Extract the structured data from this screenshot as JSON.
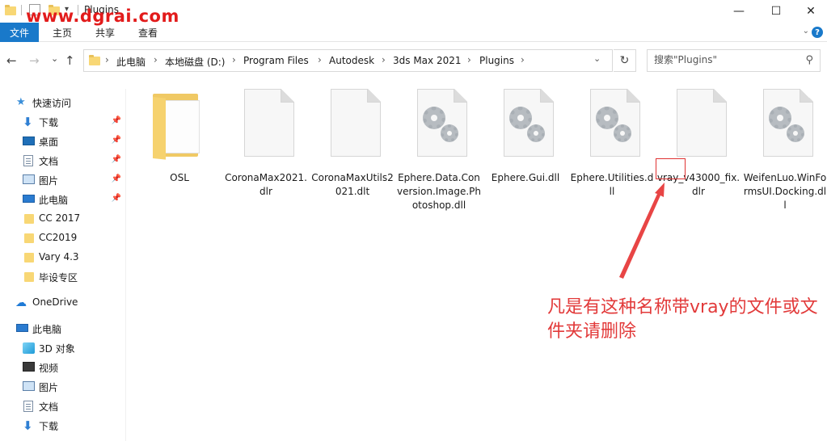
{
  "window": {
    "title": "Plugins",
    "minimize": "—",
    "maximize": "☐",
    "close": "✕"
  },
  "watermark": "www.dgrai.com",
  "ribbon": {
    "file_tab": "文件",
    "tabs": [
      "主页",
      "共享",
      "查看"
    ],
    "expand": "⌄",
    "help": "?"
  },
  "nav": {
    "back": "←",
    "forward": "→",
    "recent": "⌄",
    "up": "↑",
    "breadcrumb": [
      "此电脑",
      "本地磁盘 (D:)",
      "Program Files",
      "Autodesk",
      "3ds Max 2021",
      "Plugins"
    ],
    "crumb_sep": "›",
    "dropdown": "⌄",
    "refresh": "↻",
    "search_placeholder": "搜索\"Plugins\"",
    "search_icon": "⚲"
  },
  "sidebar": {
    "pin": "📌",
    "items": [
      {
        "label": "快速访问",
        "icon": "star-icon",
        "pinned": false
      },
      {
        "label": "下载",
        "icon": "download-icon",
        "pinned": true
      },
      {
        "label": "桌面",
        "icon": "desktop-icon",
        "pinned": true
      },
      {
        "label": "文档",
        "icon": "document-icon",
        "pinned": true
      },
      {
        "label": "图片",
        "icon": "picture-icon",
        "pinned": true
      },
      {
        "label": "此电脑",
        "icon": "computer-icon",
        "pinned": true
      },
      {
        "label": "CC 2017",
        "icon": "folder-icon",
        "pinned": false
      },
      {
        "label": "CC2019",
        "icon": "folder-icon",
        "pinned": false
      },
      {
        "label": "Vary 4.3",
        "icon": "folder-icon",
        "pinned": false
      },
      {
        "label": "毕设专区",
        "icon": "folder-icon",
        "pinned": false
      },
      {
        "label": "OneDrive",
        "icon": "cloud-icon",
        "pinned": false
      },
      {
        "label": "此电脑",
        "icon": "computer-icon",
        "pinned": false
      },
      {
        "label": "3D 对象",
        "icon": "3d-objects-icon",
        "pinned": false
      },
      {
        "label": "视频",
        "icon": "video-icon",
        "pinned": false
      },
      {
        "label": "图片",
        "icon": "picture-icon",
        "pinned": false
      },
      {
        "label": "文档",
        "icon": "document-icon",
        "pinned": false
      },
      {
        "label": "下载",
        "icon": "download-icon",
        "pinned": false
      }
    ]
  },
  "files": [
    {
      "name": "OSL",
      "type": "folder"
    },
    {
      "name": "CoronaMax2021.dlr",
      "type": "blank"
    },
    {
      "name": "CoronaMaxUtils2021.dlt",
      "type": "blank"
    },
    {
      "name": "Ephere.Data.Conversion.Image.Photoshop.dll",
      "type": "dll"
    },
    {
      "name": "Ephere.Gui.dll",
      "type": "dll"
    },
    {
      "name": "Ephere.Utilities.dll",
      "type": "dll"
    },
    {
      "name": "vray_v43000_fix.dlr",
      "type": "blank"
    },
    {
      "name": "WeifenLuo.WinFormsUI.Docking.dll",
      "type": "dll"
    }
  ],
  "annotation": {
    "text": "凡是有这种名称带vray的文件或文件夹请删除",
    "color": "#e23a3a"
  },
  "colors": {
    "accent": "#1979ca",
    "folder": "#f8d775",
    "annotation_red": "#e03232"
  }
}
